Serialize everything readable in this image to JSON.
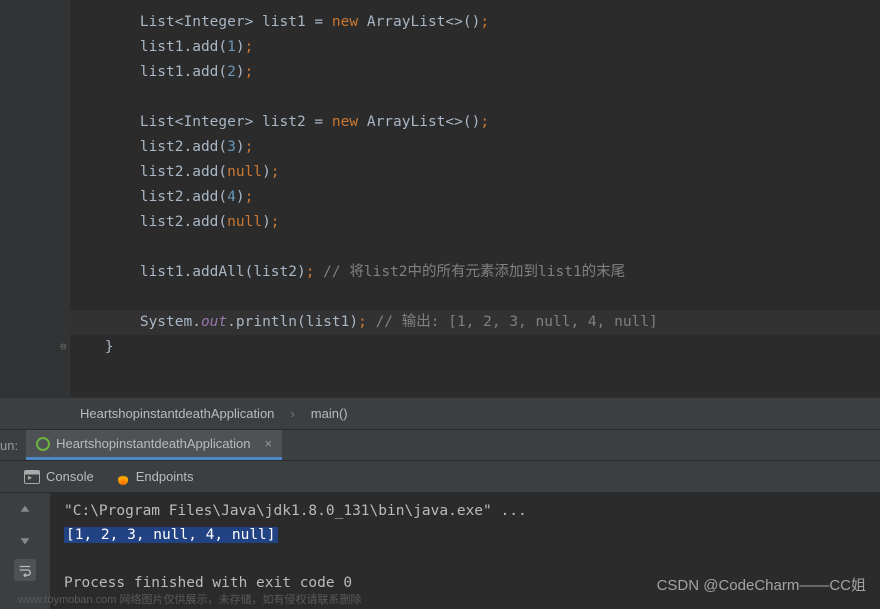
{
  "code": {
    "l1_a": "        List<Integer> list1 = ",
    "l1_b": "new",
    "l1_c": " ArrayList<>()",
    "l2_a": "        list1.add(",
    "l2_b": "1",
    "l2_c": ")",
    "l3_a": "        list1.add(",
    "l3_b": "2",
    "l3_c": ")",
    "l5_a": "        List<Integer> list2 = ",
    "l5_b": "new",
    "l5_c": " ArrayList<>()",
    "l6_a": "        list2.add(",
    "l6_b": "3",
    "l6_c": ")",
    "l7_a": "        list2.add(",
    "l7_b": "null",
    "l7_c": ")",
    "l8_a": "        list2.add(",
    "l8_b": "4",
    "l8_c": ")",
    "l9_a": "        list2.add(",
    "l9_b": "null",
    "l9_c": ")",
    "l11_a": "        list1.addAll(list2)",
    "l11_b": " // 将list2中的所有元素添加到list1的末尾",
    "l13_a": "        System.",
    "l13_b": "out",
    "l13_c": ".println(list1)",
    "l13_d": " // 输出: [1, 2, 3, null, 4, null]",
    "l14": "    }",
    "semi": ";"
  },
  "breadcrumb": {
    "class": "HeartshopinstantdeathApplication",
    "method": "main()"
  },
  "run": {
    "label": "un:",
    "tab": "HeartshopinstantdeathApplication",
    "close": "×"
  },
  "toolTabs": {
    "console": "Console",
    "endpoints": "Endpoints"
  },
  "console": {
    "cmd": "\"C:\\Program Files\\Java\\jdk1.8.0_131\\bin\\java.exe\" ...",
    "out": "[1, 2, 3, null, 4, null]",
    "blank": " ",
    "exit": "Process finished with exit code 0"
  },
  "watermark": "CSDN @CodeCharm——CC姐",
  "footerHint": "www.toymoban.com 网络图片仅供展示，未存储，如有侵权请联系删除"
}
